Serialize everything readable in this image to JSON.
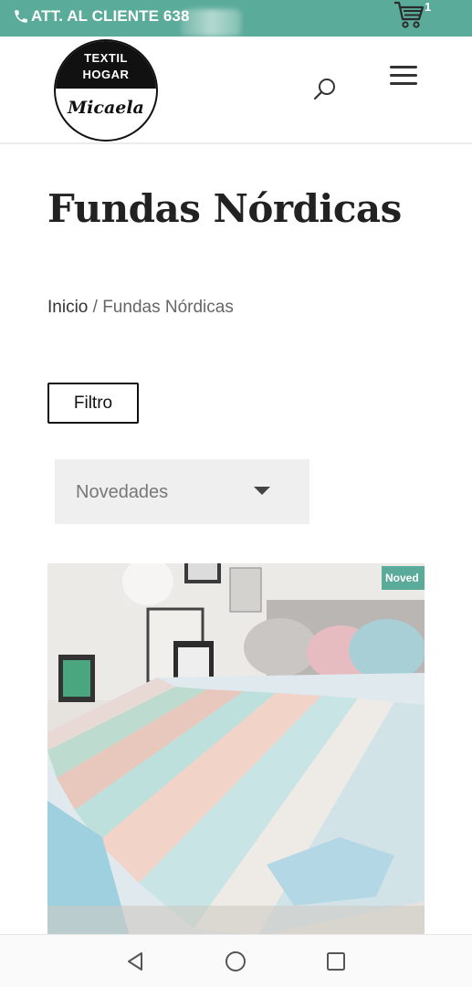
{
  "topbar": {
    "contact_text": "ATT. AL CLIENTE 638",
    "cart_count": "1",
    "icons": [
      "phone-icon",
      "cart-icon"
    ]
  },
  "header": {
    "logo_line1": "TEXTIL",
    "logo_line2": "HOGAR",
    "logo_script": "Micaela",
    "icons": [
      "search-icon",
      "hamburger-menu-icon"
    ]
  },
  "page": {
    "title": "Fundas Nórdicas",
    "breadcrumb_home": "Inicio",
    "breadcrumb_separator": " / ",
    "breadcrumb_current": "Fundas Nórdicas"
  },
  "filter": {
    "button_label": "Filtro"
  },
  "sort": {
    "selected": "Novedades"
  },
  "product": {
    "badge": "Noved"
  },
  "colors": {
    "accent": "#5aab9a",
    "text": "#222222",
    "select_bg": "#efefef"
  },
  "navbar": {
    "icons": [
      "back-icon",
      "home-icon",
      "recents-icon"
    ]
  }
}
